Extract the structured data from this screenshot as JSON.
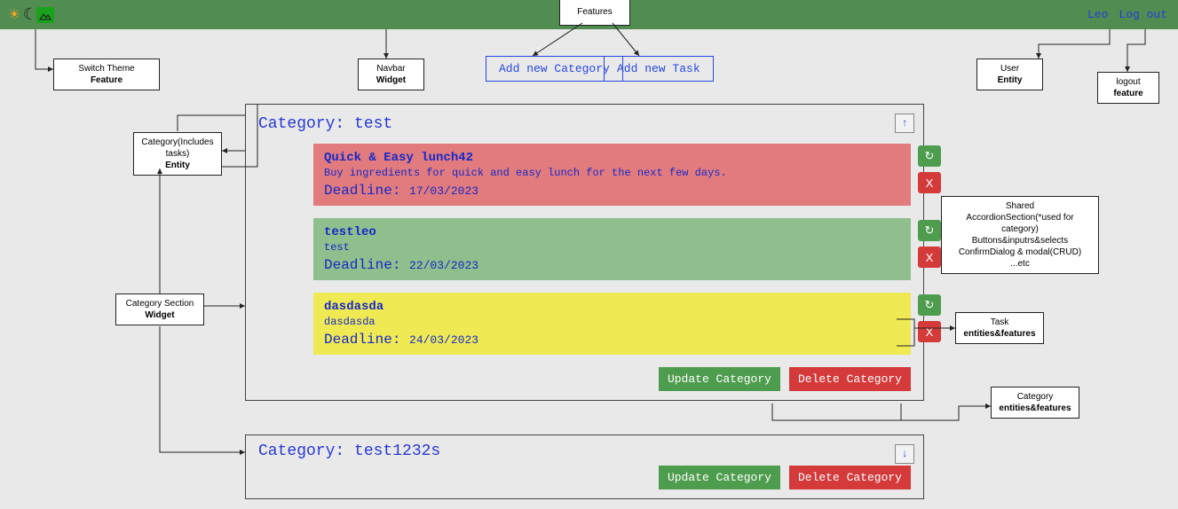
{
  "navbar": {
    "user": "Leo",
    "logout": "Log out"
  },
  "annotations": {
    "features": "Features",
    "switch_theme_l1": "Switch Theme",
    "switch_theme_l2": "Feature",
    "navbar_l1": "Navbar",
    "navbar_l2": "Widget",
    "user_l1": "User",
    "user_l2": "Entity",
    "logout_l1": "logout",
    "logout_l2": "feature",
    "category_entity_l1": "Category(Includes tasks)",
    "category_entity_l2": "Entity",
    "category_section_l1": "Category Section",
    "category_section_l2": "Widget",
    "shared_l1": "Shared",
    "shared_l2": "AccordionSection(*used for category)",
    "shared_l3": "Buttons&inputrs&selects",
    "shared_l4": "ConfirmDialog & modal(CRUD)",
    "shared_l5": "...etc",
    "task_ef_l1": "Task",
    "task_ef_l2": "entities&features",
    "cat_ef_l1": "Category",
    "cat_ef_l2": "entities&features"
  },
  "buttons": {
    "add_category": "Add new Category",
    "add_task": "Add new Task",
    "update_category": "Update Category",
    "delete_category": "Delete Category",
    "delete_x": "X",
    "refresh": "↻"
  },
  "category1": {
    "title": "Category: test",
    "tasks": [
      {
        "title": "Quick & Easy lunch42",
        "desc": "Buy ingredients for quick and easy lunch for the next few days.",
        "deadline_label": "Deadline:",
        "deadline": "17/03/2023"
      },
      {
        "title": "testleo",
        "desc": "test",
        "deadline_label": "Deadline:",
        "deadline": "22/03/2023"
      },
      {
        "title": "dasdasda",
        "desc": "dasdasda",
        "deadline_label": "Deadline:",
        "deadline": "24/03/2023"
      }
    ]
  },
  "category2": {
    "title": "Category: test1232s"
  }
}
